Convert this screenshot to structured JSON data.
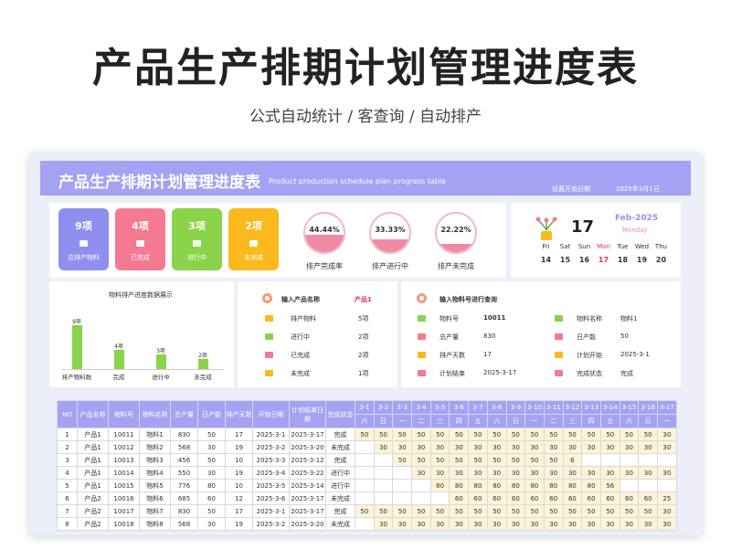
{
  "poster": {
    "title": "产品生产排期计划管理进度表",
    "subtitle": "公式自动统计 /  客查询  /  自动排产"
  },
  "banner": {
    "title_cn": "产品生产排期计划管理进度表",
    "title_en": "Product production schedule plan progress table",
    "date_label": "设置开始日期",
    "date_value": "2025年3月1日"
  },
  "status_cards": [
    {
      "count": "9项",
      "label": "总排产物料",
      "color": "#8f8ff0"
    },
    {
      "count": "4项",
      "label": "已完成",
      "color": "#f47a93"
    },
    {
      "count": "3项",
      "label": "进行中",
      "color": "#8bd34a"
    },
    {
      "count": "2项",
      "label": "未完成",
      "color": "#fbb91c"
    }
  ],
  "gauges": [
    {
      "pct": "44.44%",
      "level": 0.4444,
      "label": "排产完成率"
    },
    {
      "pct": "33.33%",
      "level": 0.3333,
      "label": "排产进行中"
    },
    {
      "pct": "22.22%",
      "level": 0.2222,
      "label": "排产未完成"
    }
  ],
  "calendar": {
    "day": "17",
    "month": "Feb-2025",
    "weekday": "Monday",
    "week_labels": [
      "Fri",
      "Sat",
      "Sun",
      "Mon",
      "Tue",
      "Wed",
      "Thu"
    ],
    "week_dates": [
      "14",
      "15",
      "16",
      "17",
      "18",
      "19",
      "20"
    ],
    "highlight_color": "#e0354f"
  },
  "chart_data": {
    "type": "bar",
    "title": "物料排产进度数据展示",
    "categories": [
      "排产物料数",
      "完成",
      "进行中",
      "未完成"
    ],
    "values": [
      9,
      4,
      3,
      2
    ],
    "value_labels": [
      "9项",
      "4项",
      "3项",
      "2项"
    ],
    "ylim": [
      0,
      9
    ]
  },
  "product_query": {
    "label": "输入产品名称",
    "value": "产品1",
    "rows": [
      {
        "label": "排产物料",
        "value": "5项",
        "color": "#fbb91c"
      },
      {
        "label": "进行中",
        "value": "2项",
        "color": "#8bd34a"
      },
      {
        "label": "已完成",
        "value": "2项",
        "color": "#f47a93"
      },
      {
        "label": "未完成",
        "value": "1项",
        "color": "#fbb91c"
      }
    ]
  },
  "material_query": {
    "label": "输入物料号进行查询",
    "left": [
      {
        "label": "物料号",
        "value": "10011",
        "color": "#8bd34a"
      },
      {
        "label": "总产量",
        "value": "830",
        "color": "#f47a93"
      },
      {
        "label": "排产天数",
        "value": "17",
        "color": "#fbb91c"
      },
      {
        "label": "计划结束",
        "value": "2025-3-17",
        "color": "#f47a93"
      }
    ],
    "right": [
      {
        "label": "物料名称",
        "value": "物料1",
        "color": "#8bd34a"
      },
      {
        "label": "日产能",
        "value": "50",
        "color": "#f47a93"
      },
      {
        "label": "计划开始",
        "value": "2025-3-1",
        "color": "#fbb91c"
      },
      {
        "label": "完成状态",
        "value": "完成",
        "color": "#f47a93"
      }
    ]
  },
  "table": {
    "headers": [
      "NO",
      "产品名称",
      "物料号",
      "物料名称",
      "总产量",
      "日产能",
      "排产天数",
      "开始日期",
      "计划结束日期",
      "完成状态"
    ],
    "dates": [
      "3-1",
      "3-2",
      "3-3",
      "3-4",
      "3-5",
      "3-6",
      "3-7",
      "3-8",
      "3-9",
      "3-10",
      "3-11",
      "3-12",
      "3-13",
      "3-14",
      "3-15",
      "3-16",
      "3-17"
    ],
    "weekdays": [
      "六",
      "日",
      "一",
      "二",
      "三",
      "四",
      "五",
      "六",
      "日",
      "一",
      "二",
      "三",
      "四",
      "五",
      "六",
      "日",
      "一"
    ],
    "rows": [
      {
        "no": "1",
        "product": "产品1",
        "code": "10011",
        "name": "物料1",
        "total": "830",
        "cap": "50",
        "days": "17",
        "start": "2025-3-1",
        "end": "2025-3-17",
        "status": "完成",
        "sched": [
          "50",
          "50",
          "50",
          "50",
          "50",
          "50",
          "50",
          "50",
          "50",
          "50",
          "50",
          "50",
          "50",
          "50",
          "50",
          "50",
          "30"
        ]
      },
      {
        "no": "2",
        "product": "产品1",
        "code": "10012",
        "name": "物料2",
        "total": "568",
        "cap": "30",
        "days": "19",
        "start": "2025-3-2",
        "end": "2025-3-20",
        "status": "未完成",
        "sched": [
          "",
          "30",
          "30",
          "30",
          "30",
          "30",
          "30",
          "30",
          "30",
          "30",
          "30",
          "30",
          "30",
          "30",
          "30",
          "30",
          "30"
        ]
      },
      {
        "no": "3",
        "product": "产品1",
        "code": "10013",
        "name": "物料3",
        "total": "456",
        "cap": "50",
        "days": "10",
        "start": "2025-3-3",
        "end": "2025-3-12",
        "status": "完成",
        "sched": [
          "",
          "",
          "50",
          "50",
          "50",
          "50",
          "50",
          "50",
          "50",
          "50",
          "50",
          "6",
          "",
          "",
          "",
          "",
          ""
        ]
      },
      {
        "no": "4",
        "product": "产品1",
        "code": "10014",
        "name": "物料4",
        "total": "550",
        "cap": "30",
        "days": "19",
        "start": "2025-3-4",
        "end": "2025-3-22",
        "status": "进行中",
        "sched": [
          "",
          "",
          "",
          "30",
          "30",
          "30",
          "30",
          "30",
          "30",
          "30",
          "30",
          "30",
          "30",
          "30",
          "30",
          "30",
          "30"
        ]
      },
      {
        "no": "5",
        "product": "产品1",
        "code": "10015",
        "name": "物料5",
        "total": "776",
        "cap": "80",
        "days": "10",
        "start": "2025-3-5",
        "end": "2025-3-14",
        "status": "进行中",
        "sched": [
          "",
          "",
          "",
          "",
          "80",
          "80",
          "80",
          "80",
          "80",
          "80",
          "80",
          "80",
          "80",
          "56",
          "",
          "",
          ""
        ]
      },
      {
        "no": "6",
        "product": "产品2",
        "code": "10016",
        "name": "物料6",
        "total": "685",
        "cap": "60",
        "days": "12",
        "start": "2025-3-6",
        "end": "2025-3-17",
        "status": "未完成",
        "sched": [
          "",
          "",
          "",
          "",
          "",
          "60",
          "60",
          "60",
          "60",
          "60",
          "60",
          "60",
          "60",
          "60",
          "60",
          "60",
          "25"
        ]
      },
      {
        "no": "7",
        "product": "产品2",
        "code": "10017",
        "name": "物料7",
        "total": "830",
        "cap": "50",
        "days": "17",
        "start": "2025-3-1",
        "end": "2025-3-17",
        "status": "完成",
        "sched": [
          "50",
          "50",
          "50",
          "50",
          "50",
          "50",
          "50",
          "50",
          "50",
          "50",
          "50",
          "50",
          "50",
          "50",
          "50",
          "50",
          "30"
        ]
      },
      {
        "no": "8",
        "product": "产品2",
        "code": "10018",
        "name": "物料8",
        "total": "568",
        "cap": "30",
        "days": "19",
        "start": "2025-3-2",
        "end": "2025-3-20",
        "status": "未完成",
        "sched": [
          "",
          "30",
          "30",
          "30",
          "30",
          "30",
          "30",
          "30",
          "30",
          "30",
          "30",
          "30",
          "30",
          "30",
          "30",
          "30",
          "30"
        ]
      }
    ]
  }
}
